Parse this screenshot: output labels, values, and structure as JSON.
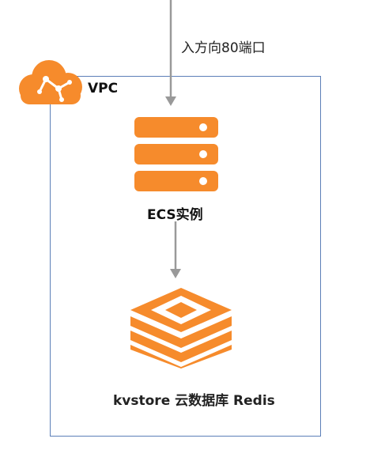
{
  "diagram": {
    "inbound_label": "入方向80端口",
    "vpc_label": "VPC",
    "ecs_label": "ECS实例",
    "redis_label": "kvstore 云数据库 Redis"
  },
  "colors": {
    "accent_orange": "#f68b2c",
    "vpc_border": "#5c7fb8",
    "arrow_gray": "#999999"
  },
  "icons": {
    "cloud": "cloud-icon",
    "server": "server-icon",
    "redis": "redis-icon"
  }
}
